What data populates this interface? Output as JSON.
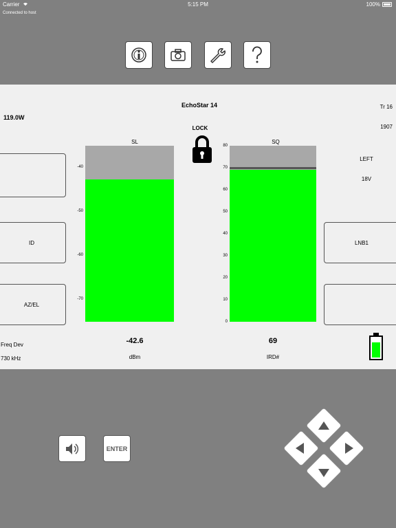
{
  "status_bar": {
    "carrier": "Carrier",
    "time": "5:15 PM",
    "battery": "100%"
  },
  "connection": "Connected to host",
  "toolbar": {
    "icons": [
      "info-icon",
      "camera-icon",
      "wrench-icon",
      "help-icon"
    ]
  },
  "satellite": {
    "name": "EchoStar 14",
    "position": "119.0W",
    "transponder": "Tr 16",
    "frequency": "1907",
    "lock_label": "LOCK"
  },
  "side_info": {
    "polarity": "LEFT",
    "voltage": "18V"
  },
  "left_buttons": [
    "",
    "ID",
    "AZ/EL"
  ],
  "right_buttons": [
    "LNB1",
    ""
  ],
  "sl_meter": {
    "label": "SL",
    "ticks": [
      "-40",
      "-50",
      "-60",
      "-70"
    ],
    "value": "-42.6",
    "unit": "dBm",
    "fill_fraction": 0.81
  },
  "sq_meter": {
    "label": "SQ",
    "ticks": [
      "80",
      "70",
      "60",
      "50",
      "40",
      "30",
      "20",
      "10",
      "0"
    ],
    "value": "69",
    "unit": "IRD#",
    "fill_fraction": 0.8625,
    "marker": 70
  },
  "freq_dev": {
    "label": "Freq Dev",
    "value": "730 kHz"
  },
  "device_battery_level": 0.7,
  "controls": {
    "enter_label": "ENTER"
  },
  "colors": {
    "signal": "#00ff00",
    "meter_bg": "#a8a8a8",
    "panel": "#f0f0f0",
    "background": "#808080"
  }
}
